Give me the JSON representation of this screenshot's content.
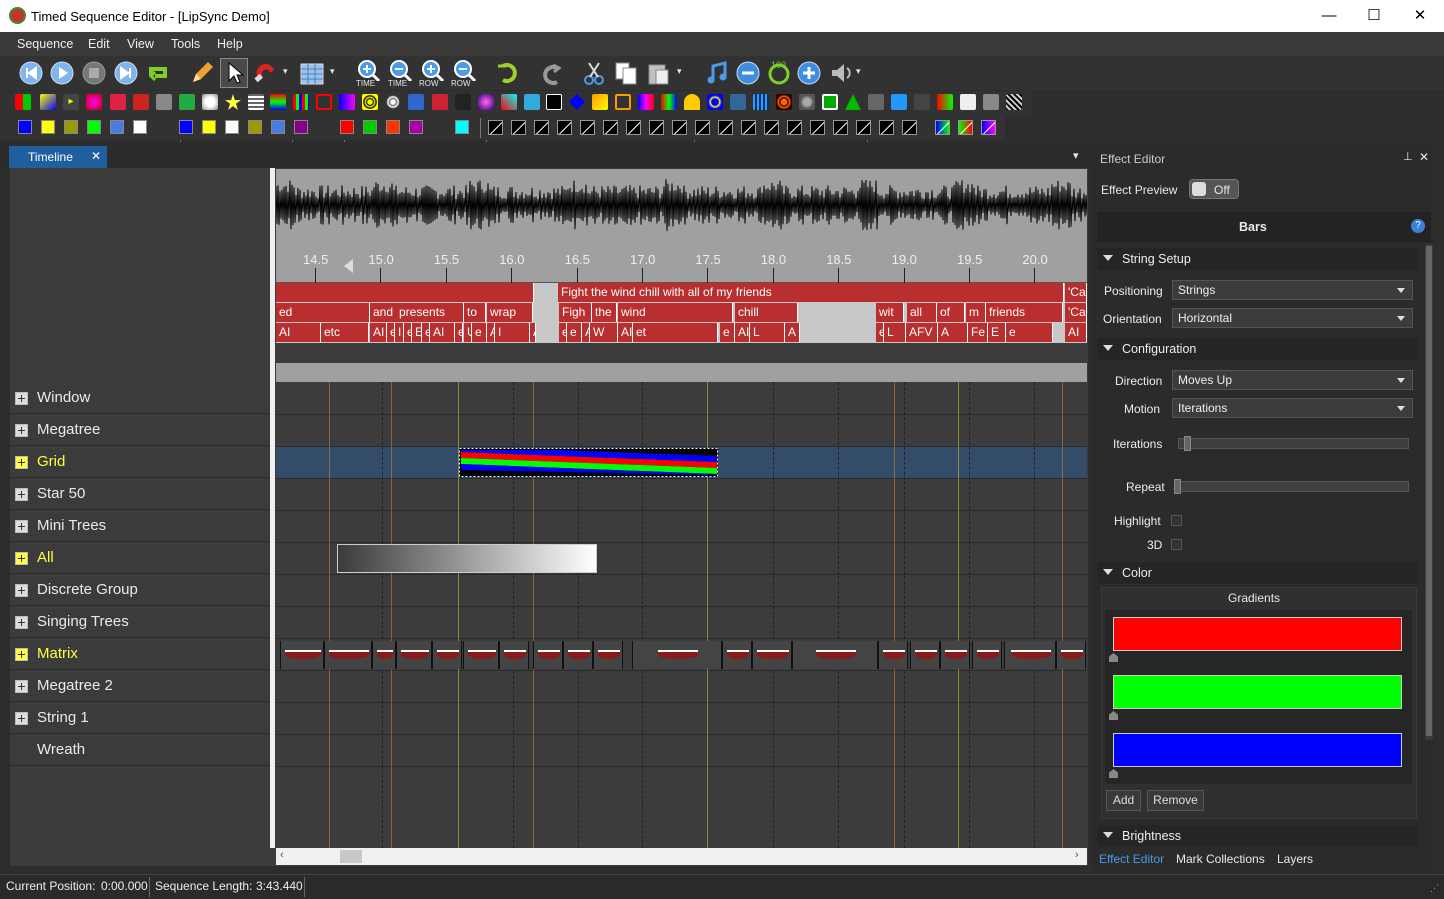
{
  "window": {
    "title": "Timed Sequence Editor - [LipSync Demo]",
    "minimize": "—",
    "maximize": "☐",
    "close": "✕"
  },
  "menu": [
    "Sequence",
    "Edit",
    "View",
    "Tools",
    "Help"
  ],
  "toolbar": {
    "zoom_labels": [
      "TIME",
      "TIME",
      "ROW",
      "ROW"
    ],
    "zoom_in": "+",
    "zoom_out": "−",
    "zoom100": "100"
  },
  "palette_colors": [
    "#0000ff",
    "#ffff00",
    "#999900",
    "#00ff00",
    "#4a7be0",
    "#ffffff",
    "#0000ff",
    "#ffff00",
    "#ffffff",
    "#999900",
    "#4a7be0",
    "#880088",
    "#ff0000",
    "#00cc00",
    "#ff3300",
    "#aa00aa",
    "#00ffff"
  ],
  "tabs": {
    "timeline": "Timeline",
    "timeline_close": "✕",
    "dropdown": "▾"
  },
  "timeline": {
    "ticks": [
      "14.5",
      "15.0",
      "15.5",
      "16.0",
      "16.5",
      "17.0",
      "17.5",
      "18.0",
      "18.5",
      "19.0",
      "19.5",
      "20.0"
    ],
    "phrases": [
      "",
      "Fight the wind chill with all of my friends",
      "'Cau"
    ],
    "words": [
      "ed",
      "and",
      "presents",
      "to",
      "wrap",
      "Figh",
      "the",
      "wind",
      "chill",
      "wit",
      "all",
      "of",
      "m",
      "friends",
      "'Cau"
    ],
    "phonemes": [
      "AI",
      "etc",
      "AI",
      "e",
      "I",
      "e",
      "E",
      "e",
      "AI",
      "e",
      "U",
      "e",
      "AI",
      "I",
      "AI",
      "e",
      "e",
      "AI",
      "W",
      "AI",
      "et",
      "e",
      "AI",
      "L",
      "A",
      "e",
      "L",
      "AFV",
      "A",
      "Fe",
      "E",
      "e",
      "AI"
    ]
  },
  "rows": [
    {
      "label": "Window",
      "highlight": false
    },
    {
      "label": "Megatree",
      "highlight": false
    },
    {
      "label": "Grid",
      "highlight": true
    },
    {
      "label": "Star 50",
      "highlight": false
    },
    {
      "label": "Mini Trees",
      "highlight": false
    },
    {
      "label": "All",
      "highlight": true
    },
    {
      "label": "Discrete Group",
      "highlight": false
    },
    {
      "label": "Singing Trees",
      "highlight": false
    },
    {
      "label": "Matrix",
      "highlight": true
    },
    {
      "label": "Megatree 2",
      "highlight": false
    },
    {
      "label": "String 1",
      "highlight": false
    },
    {
      "label": "Wreath",
      "highlight": false
    }
  ],
  "effect_editor": {
    "title": "Effect Editor",
    "pin": "⊥",
    "close": "✕",
    "preview_label": "Effect Preview",
    "preview_state": "Off",
    "effect_name": "Bars",
    "help": "?",
    "sections": {
      "string_setup": "String Setup",
      "configuration": "Configuration",
      "color": "Color",
      "brightness": "Brightness"
    },
    "positioning_label": "Positioning",
    "positioning_value": "Strings",
    "orientation_label": "Orientation",
    "orientation_value": "Horizontal",
    "direction_label": "Direction",
    "direction_value": "Moves Up",
    "motion_label": "Motion",
    "motion_value": "Iterations",
    "iterations_label": "Iterations",
    "repeat_label": "Repeat",
    "highlight_label": "Highlight",
    "three_d_label": "3D",
    "gradients_label": "Gradients",
    "gradient_colors": [
      "#ff0000",
      "#00ff00",
      "#0000ff"
    ],
    "add": "Add",
    "remove": "Remove"
  },
  "bottom_tabs": [
    "Effect Editor",
    "Mark Collections",
    "Layers"
  ],
  "status": {
    "position_label": "Current Position:",
    "position_value": "0:00.000",
    "length_label": "Sequence Length:",
    "length_value": "3:43.440"
  }
}
